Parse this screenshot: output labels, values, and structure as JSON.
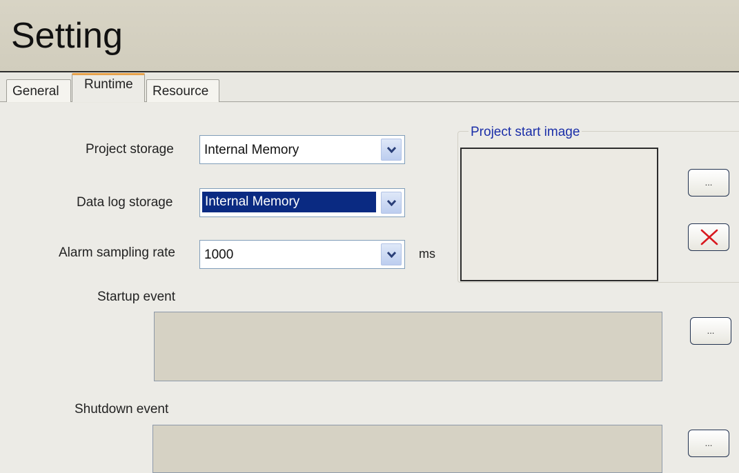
{
  "window": {
    "title": "Setting"
  },
  "tabs": [
    {
      "label": "General",
      "active": false
    },
    {
      "label": "Runtime",
      "active": true
    },
    {
      "label": "Resource",
      "active": false
    }
  ],
  "form": {
    "project_storage": {
      "label": "Project storage",
      "value": "Internal Memory"
    },
    "data_log_storage": {
      "label": "Data log storage",
      "value": "Internal Memory",
      "selected": true
    },
    "alarm_sampling_rate": {
      "label": "Alarm sampling rate",
      "value": "1000",
      "unit": "ms"
    },
    "startup_event": {
      "label": "Startup event",
      "value": ""
    },
    "shutdown_event": {
      "label": "Shutdown event",
      "value": ""
    }
  },
  "start_image": {
    "legend": "Project start image",
    "browse_label": "...",
    "delete_icon": "red-x-icon"
  },
  "buttons": {
    "browse_label": "..."
  },
  "colors": {
    "title_bar": "#d3cfbf",
    "active_tab_accent": "#e8a24a",
    "selection": "#0a2a82",
    "legend_text": "#1a2ea8",
    "delete_x": "#d8191f"
  },
  "icons": {
    "dropdown": "chevron-down-icon",
    "delete": "red-x-icon"
  }
}
